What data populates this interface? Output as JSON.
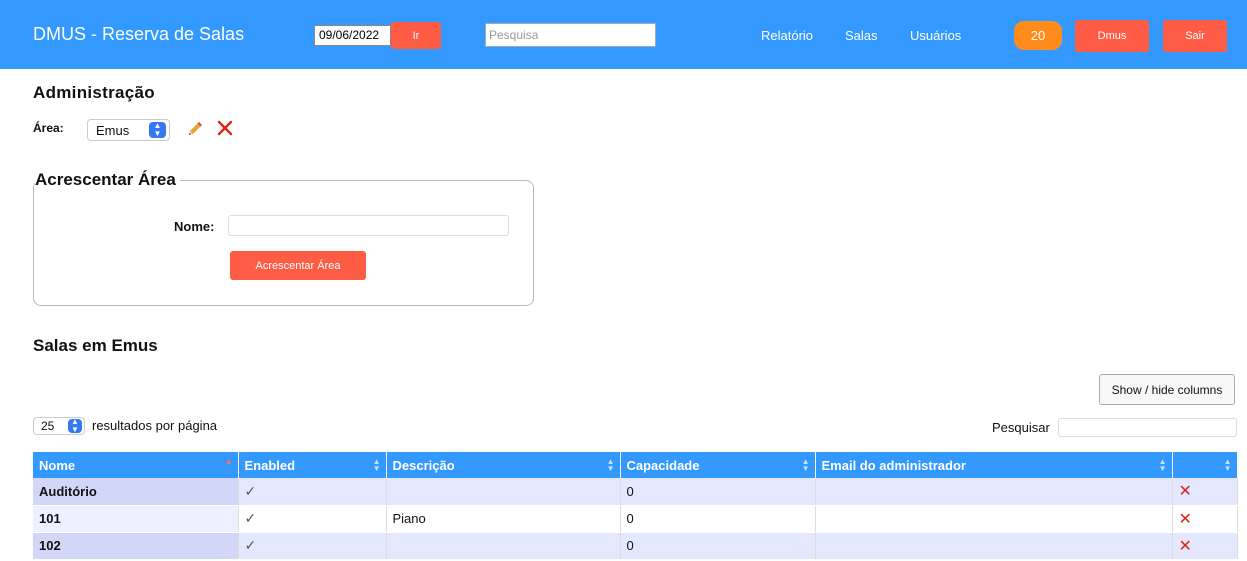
{
  "header": {
    "title": "DMUS - Reserva de Salas",
    "date_value": "09/06/2022",
    "go_label": "Ir",
    "search_placeholder": "Pesquisa",
    "nav": [
      "Relatório",
      "Salas",
      "Usuários"
    ],
    "badge_count": "20",
    "user_label": "Dmus",
    "logout_label": "Sair",
    "colors": {
      "bar": "#3399ff",
      "button": "#ff5c45",
      "badge": "#ff8c1a"
    }
  },
  "admin": {
    "title": "Administração",
    "area_label": "Área:",
    "area_selected": "Emus",
    "edit_icon": "pencil-icon",
    "delete_icon": "delete-x-icon"
  },
  "add_area": {
    "legend": "Acrescentar Área",
    "name_label": "Nome:",
    "name_value": "",
    "submit_label": "Acrescentar Área"
  },
  "rooms": {
    "title": "Salas em Emus",
    "show_hide_label": "Show / hide columns",
    "page_length": "25",
    "page_length_label": "resultados por página",
    "search_label": "Pesquisar",
    "columns": [
      "Nome",
      "Enabled",
      "Descrição",
      "Capacidade",
      "Email do administrador",
      ""
    ],
    "rows": [
      {
        "nome": "Auditório",
        "enabled": "✓",
        "descricao": "",
        "capacidade": "0",
        "email": ""
      },
      {
        "nome": "101",
        "enabled": "✓",
        "descricao": "Piano",
        "capacidade": "0",
        "email": ""
      },
      {
        "nome": "102",
        "enabled": "✓",
        "descricao": "",
        "capacidade": "0",
        "email": ""
      }
    ]
  }
}
